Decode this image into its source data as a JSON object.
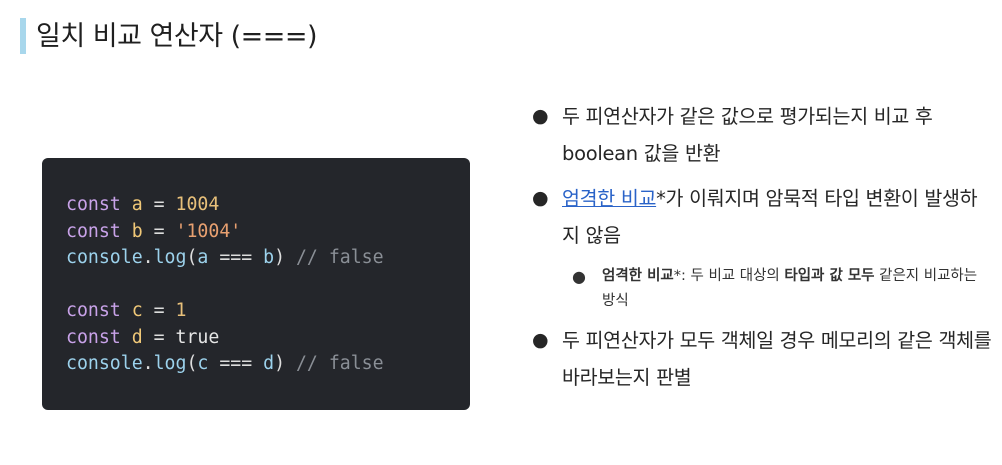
{
  "title": "일치 비교 연산자 (===)",
  "code_lines": [
    [
      {
        "t": "const",
        "c": "kw"
      },
      {
        "t": " ",
        "c": "op"
      },
      {
        "t": "a",
        "c": "var"
      },
      {
        "t": " = ",
        "c": "op"
      },
      {
        "t": "1004",
        "c": "num"
      }
    ],
    [
      {
        "t": "const",
        "c": "kw"
      },
      {
        "t": " ",
        "c": "op"
      },
      {
        "t": "b",
        "c": "var"
      },
      {
        "t": " = ",
        "c": "op"
      },
      {
        "t": "'1004'",
        "c": "str"
      }
    ],
    [
      {
        "t": "console",
        "c": "fn"
      },
      {
        "t": ".",
        "c": "op"
      },
      {
        "t": "log",
        "c": "fn"
      },
      {
        "t": "(",
        "c": "op"
      },
      {
        "t": "a",
        "c": "fn"
      },
      {
        "t": " === ",
        "c": "op"
      },
      {
        "t": "b",
        "c": "fn"
      },
      {
        "t": ") ",
        "c": "op"
      },
      {
        "t": "// false",
        "c": "cmt"
      }
    ],
    [],
    [
      {
        "t": "const",
        "c": "kw"
      },
      {
        "t": " ",
        "c": "op"
      },
      {
        "t": "c",
        "c": "var"
      },
      {
        "t": " = ",
        "c": "op"
      },
      {
        "t": "1",
        "c": "num"
      }
    ],
    [
      {
        "t": "const",
        "c": "kw"
      },
      {
        "t": " ",
        "c": "op"
      },
      {
        "t": "d",
        "c": "var"
      },
      {
        "t": " = ",
        "c": "op"
      },
      {
        "t": "true",
        "c": "bool"
      }
    ],
    [
      {
        "t": "console",
        "c": "fn"
      },
      {
        "t": ".",
        "c": "op"
      },
      {
        "t": "log",
        "c": "fn"
      },
      {
        "t": "(",
        "c": "op"
      },
      {
        "t": "c",
        "c": "fn"
      },
      {
        "t": " === ",
        "c": "op"
      },
      {
        "t": "d",
        "c": "fn"
      },
      {
        "t": ") ",
        "c": "op"
      },
      {
        "t": "// false",
        "c": "cmt"
      }
    ]
  ],
  "bullets": {
    "b1": "두 피연산자가 같은 값으로 평가되는지 비교 후 boolean 값을 반환",
    "b2_link": "엄격한 비교",
    "b2_rest": "*가 이뤄지며 암묵적 타입 변환이 발생하지 않음",
    "sub_bold1": "엄격한 비교",
    "sub_t1": "*: 두 비교 대상의 ",
    "sub_bold2": "타입과 값 모두",
    "sub_t2": " 같은지 비교하는 방식",
    "b3": "두 피연산자가 모두 객체일 경우 메모리의 같은 객체를 바라보는지 판별"
  },
  "colors": {
    "title_bar": "#a8d7ec",
    "code_bg": "#24262b",
    "link": "#2a63c8"
  }
}
